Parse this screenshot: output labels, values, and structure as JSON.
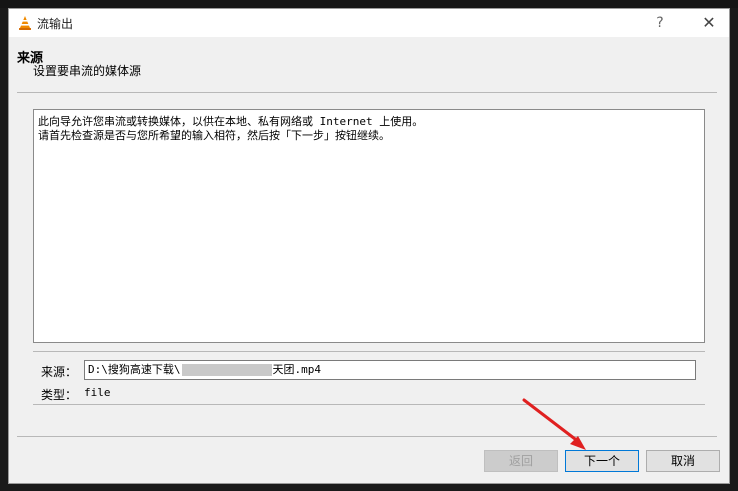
{
  "window": {
    "title": "流输出",
    "help_glyph": "?",
    "close_glyph": "✕"
  },
  "header": {
    "title": "来源",
    "subtitle": "设置要串流的媒体源"
  },
  "description": {
    "line1": "此向导允许您串流或转换媒体，以供在本地、私有网络或 Internet 上使用。",
    "line2": "请首先检查源是否与您所希望的输入相符，然后按「下一步」按钮继续。"
  },
  "source": {
    "label": "来源：",
    "value_prefix": "D:\\搜狗高速下载\\",
    "value_suffix": "天团.mp4"
  },
  "type": {
    "label": "类型：",
    "value": "file"
  },
  "buttons": {
    "back": "返回",
    "next": "下一个",
    "cancel": "取消"
  }
}
